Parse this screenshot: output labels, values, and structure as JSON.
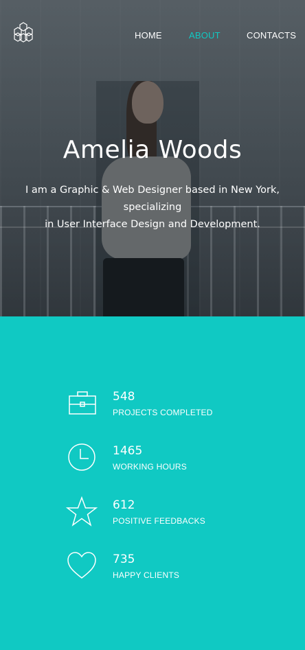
{
  "nav": {
    "items": [
      {
        "label": "HOME",
        "active": false
      },
      {
        "label": "ABOUT",
        "active": true
      },
      {
        "label": "CONTACTS",
        "active": false
      }
    ]
  },
  "hero": {
    "name": "Amelia Woods",
    "tagline_line1": "I am a Graphic & Web Designer based in New York,",
    "tagline_line2": "specializing",
    "tagline_line3": "in User Interface Design and Development."
  },
  "stats": [
    {
      "icon": "briefcase-icon",
      "value": "548",
      "label": "PROJECTS COMPLETED"
    },
    {
      "icon": "clock-icon",
      "value": "1465",
      "label": "WORKING HOURS"
    },
    {
      "icon": "star-icon",
      "value": "612",
      "label": "POSITIVE FEEDBACKS"
    },
    {
      "icon": "heart-icon",
      "value": "735",
      "label": "HAPPY CLIENTS"
    }
  ],
  "colors": {
    "accent": "#10c9c3",
    "text_light": "#ffffff"
  }
}
